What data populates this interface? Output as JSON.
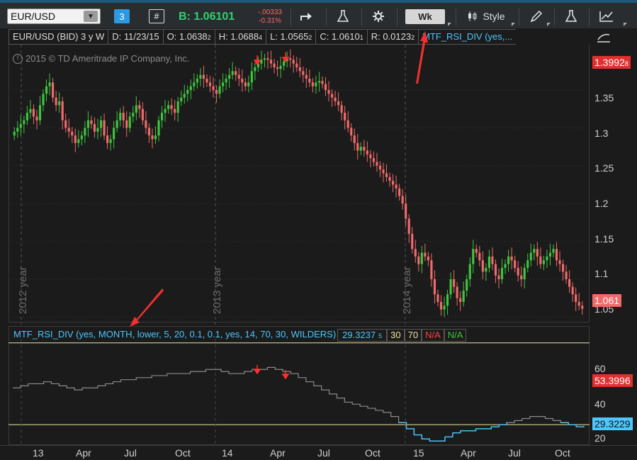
{
  "toolbar": {
    "symbol": "EUR/USD",
    "link_number": "3",
    "hash_icon": "#",
    "bid_text": "B: 1.06101",
    "change_abs": "-.00333",
    "change_pct": "-0.31%",
    "timeframe": "Wk",
    "style_label": "Style",
    "icons": [
      "share-icon",
      "flask-icon",
      "gear-icon",
      "candle-icon",
      "pencil-icon",
      "flask-icon",
      "drawings-icon"
    ]
  },
  "header": {
    "title": "EUR/USD (BID) 3 y W",
    "date": "D: 11/23/15",
    "open": "O: 1.0638",
    "open_sub": "2",
    "high": "H: 1.0688",
    "high_sub": "4",
    "low": "L: 1.0565",
    "low_sub": "2",
    "close": "C: 1.0610",
    "close_sub": "1",
    "range": "R: 0.0123",
    "range_sub": "2",
    "study": "MTF_RSI_DIV (yes,..."
  },
  "watermark": "2015 © TD Ameritrade IP Company, Inc.",
  "price_axis": {
    "ticks": [
      "1.35",
      "1.3",
      "1.25",
      "1.2",
      "1.15",
      "1.1",
      "1.05"
    ],
    "high_tag": "1.3992",
    "high_tag_sub": "8",
    "last_tag": "1.061"
  },
  "year_labels": [
    "2012 year",
    "2013 year",
    "2014 year"
  ],
  "lower": {
    "study_label": "MTF_RSI_DIV (yes, MONTH, lower, 5, 20, 0.1, 0.1, yes, 14, 70, 30, WILDERS)",
    "value": "29.3237",
    "value_sub": "5",
    "lvl30": "30",
    "lvl70": "70",
    "na1": "N/A",
    "na2": "N/A",
    "ticks": [
      "60",
      "40",
      "20"
    ],
    "tag_red": "53.3996",
    "tag_cyan": "29.3229"
  },
  "time_axis": [
    "13",
    "Apr",
    "Jul",
    "Oct",
    "14",
    "Apr",
    "Jul",
    "Oct",
    "15",
    "Apr",
    "Jul",
    "Oct"
  ],
  "colors": {
    "up": "#3fc43f",
    "down": "#f06a6a",
    "accent_cyan": "#4cc7ff",
    "level_line": "#e8e6a0",
    "red_tag": "#e03030",
    "toolbar_bg": "#2a2d30"
  },
  "chart_data": {
    "type": "candlestick",
    "start": "2012-11",
    "interval": "week",
    "close": [
      1.295,
      1.3,
      1.305,
      1.31,
      1.32,
      1.325,
      1.315,
      1.31,
      1.33,
      1.345,
      1.355,
      1.36,
      1.34,
      1.33,
      1.335,
      1.31,
      1.3,
      1.295,
      1.29,
      1.28,
      1.285,
      1.29,
      1.3,
      1.31,
      1.305,
      1.295,
      1.3,
      1.31,
      1.29,
      1.28,
      1.285,
      1.3,
      1.31,
      1.32,
      1.31,
      1.3,
      1.315,
      1.32,
      1.33,
      1.325,
      1.31,
      1.3,
      1.29,
      1.285,
      1.29,
      1.31,
      1.32,
      1.325,
      1.33,
      1.325,
      1.32,
      1.335,
      1.34,
      1.345,
      1.35,
      1.355,
      1.36,
      1.365,
      1.37,
      1.365,
      1.36,
      1.355,
      1.35,
      1.345,
      1.355,
      1.36,
      1.365,
      1.37,
      1.375,
      1.37,
      1.365,
      1.36,
      1.355,
      1.36,
      1.375,
      1.38,
      1.385,
      1.39,
      1.392,
      1.39,
      1.385,
      1.38,
      1.378,
      1.382,
      1.388,
      1.392,
      1.39,
      1.385,
      1.38,
      1.375,
      1.37,
      1.365,
      1.36,
      1.355,
      1.36,
      1.362,
      1.358,
      1.35,
      1.345,
      1.34,
      1.335,
      1.33,
      1.32,
      1.31,
      1.3,
      1.29,
      1.28,
      1.27,
      1.275,
      1.27,
      1.265,
      1.26,
      1.255,
      1.25,
      1.245,
      1.24,
      1.235,
      1.23,
      1.225,
      1.22,
      1.21,
      1.2,
      1.18,
      1.16,
      1.14,
      1.13,
      1.12,
      1.135,
      1.13,
      1.125,
      1.1,
      1.08,
      1.07,
      1.06,
      1.065,
      1.08,
      1.1,
      1.09,
      1.075,
      1.07,
      1.085,
      1.1,
      1.12,
      1.14,
      1.135,
      1.125,
      1.11,
      1.115,
      1.13,
      1.12,
      1.105,
      1.1,
      1.115,
      1.12,
      1.13,
      1.125,
      1.115,
      1.105,
      1.1,
      1.115,
      1.125,
      1.135,
      1.14,
      1.13,
      1.12,
      1.125,
      1.13,
      1.135,
      1.14,
      1.125,
      1.12,
      1.11,
      1.1,
      1.09,
      1.08,
      1.07,
      1.065,
      1.061
    ],
    "ylim": [
      1.04,
      1.41
    ],
    "rsi": [
      48,
      49,
      50,
      50,
      51,
      50,
      49,
      48,
      47,
      48,
      48,
      49,
      50,
      51,
      52,
      52,
      53,
      53,
      54,
      54,
      55,
      55,
      55,
      56,
      56,
      57,
      57,
      56,
      55,
      55,
      56,
      57,
      57,
      58,
      57,
      56,
      55,
      53,
      51,
      49,
      47,
      45,
      43,
      41,
      40,
      39,
      38,
      37,
      36,
      34,
      31,
      28,
      25,
      23,
      22,
      22,
      24,
      26,
      27,
      27,
      28,
      28,
      29,
      30,
      31,
      32,
      33,
      34,
      34,
      33,
      32,
      31,
      30,
      29,
      29.3
    ],
    "rsi_ylim": [
      20,
      72
    ],
    "rsi_levels": [
      30,
      70
    ]
  }
}
